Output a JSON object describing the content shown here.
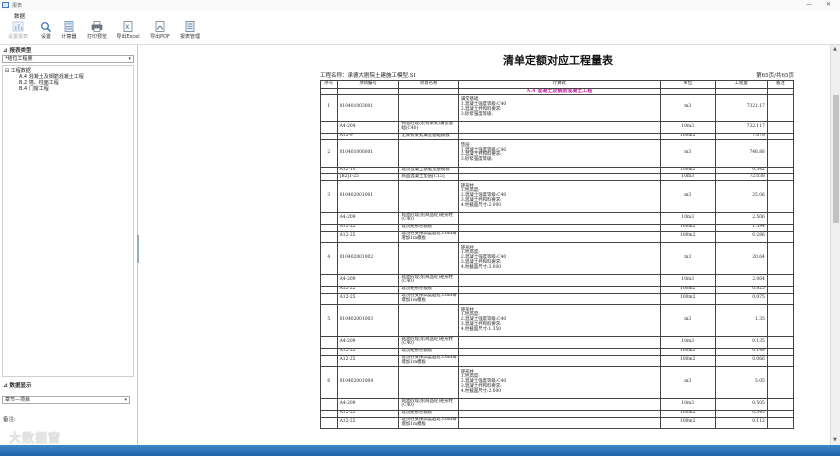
{
  "window": {
    "title": "报表",
    "minimize": "—",
    "close": "✕"
  },
  "menu": {
    "items": [
      {
        "label": "数据"
      }
    ]
  },
  "toolbar": {
    "tools": [
      {
        "label": "设置报表",
        "icon": "bar-chart-icon",
        "enabled": false
      },
      {
        "label": "设置",
        "icon": "search-icon",
        "enabled": true
      },
      {
        "label": "计算器",
        "icon": "calculator-icon",
        "enabled": true
      },
      {
        "label": "打印预览",
        "icon": "printer-icon",
        "enabled": true
      },
      {
        "label": "导出Excel",
        "icon": "excel-icon",
        "enabled": true
      },
      {
        "label": "导出PDF",
        "icon": "pdf-icon",
        "enabled": true
      },
      {
        "label": "报表管理",
        "icon": "report-manage-icon",
        "enabled": true
      }
    ]
  },
  "left": {
    "report_type_header": "报表类型",
    "report_type_value": "*结位工程量",
    "tree": [
      {
        "label": "⊟ 工程数据",
        "level": 0
      },
      {
        "label": "A.4 混凝土及钢筋混凝土工程",
        "level": 1
      },
      {
        "label": "B.2 墙、柱面工程",
        "level": 1
      },
      {
        "label": "B.4 门窗工程",
        "level": 1
      }
    ],
    "data_display_header": "数据显示",
    "data_display_value": "章节—项目",
    "remark_label": "备注:"
  },
  "report": {
    "title": "清单定额对应工程量表",
    "project_name": "工程名称：承德大剧院土建施工模型.SI",
    "page_info": "第65页/共65页",
    "columns": [
      "序号",
      "项目编号",
      "项目名称",
      "计算式",
      "单位",
      "工程量",
      "备注"
    ],
    "section_title": "A.4 混凝土及钢筋混凝土工程",
    "groups": [
      {
        "no": "1",
        "code": "010401003001",
        "name": [
          "满堂基础",
          "1.混凝土强度等级:C40",
          "2.混凝土拌和料要求:",
          "3.砂浆强度等级:"
        ],
        "unit": "m3",
        "qty": "7321.17",
        "subs": [
          {
            "code": "A4-204",
            "name": [
              "商混砼现浇(有梁式)满堂基",
              "础(C40)"
            ],
            "unit": "10m3",
            "qty": "732.117"
          },
          {
            "code": "A12-9",
            "name": [
              "无梁有梁式满堂基础模板"
            ],
            "unit": "100m2",
            "qty": "7.678"
          }
        ]
      },
      {
        "no": "2",
        "code": "010401006001",
        "name": [
          "垫层",
          "1.混凝土强度等级:C40",
          "2.混凝土拌和料要求:",
          "3.砂浆强度等级:"
        ],
        "unit": "m3",
        "qty": "748.88",
        "subs": [
          {
            "code": "A12-10",
            "name": [
              "现浇混凝土基础垫层模板"
            ],
            "unit": "100m2",
            "qty": "0.542"
          },
          {
            "code": "[B2]1-25",
            "name": [
              "商品混凝土垫层[C15]"
            ],
            "unit": "10m3",
            "qty": "72.038"
          }
        ]
      },
      {
        "no": "3",
        "code": "010402001001",
        "name": [
          "矩形柱",
          "1.柱高度:",
          "2.混凝土强度等级:C40",
          "3.混凝土拌和料要求:",
          "4.柱截面尺寸:2.000"
        ],
        "unit": "m3",
        "qty": "25.06",
        "subs": [
          {
            "code": "A4-209",
            "name": [
              "商混砼现浇(商品砼)矩形柱",
              "(C40)"
            ],
            "unit": "10m3",
            "qty": "2.506"
          },
          {
            "code": "A12-22",
            "name": [
              "现浇矩形柱模板"
            ],
            "unit": "100m2",
            "qty": "1.394"
          },
          {
            "code": "A12-25",
            "name": [
              "现浇柱支撑高度超过3.6m每",
              "增加1m模板"
            ],
            "unit": "100m2",
            "qty": "0.286"
          }
        ]
      },
      {
        "no": "4",
        "code": "010402001002",
        "name": [
          "矩形柱",
          "1.柱高度:",
          "2.混凝土强度等级:C40",
          "3.混凝土拌和料要求:",
          "4.柱截面尺寸:3.000"
        ],
        "unit": "m3",
        "qty": "20.64",
        "subs": [
          {
            "code": "A4-209",
            "name": [
              "商混砼现浇(商品砼)矩形柱",
              "(C40)"
            ],
            "unit": "10m3",
            "qty": "2.064"
          },
          {
            "code": "A12-22",
            "name": [
              "现浇矩形柱模板"
            ],
            "unit": "100m2",
            "qty": "0.825"
          },
          {
            "code": "A12-25",
            "name": [
              "现浇柱支撑高度超过3.6m每",
              "增加1m模板"
            ],
            "unit": "100m2",
            "qty": "0.075"
          }
        ]
      },
      {
        "no": "5",
        "code": "010402001003",
        "name": [
          "矩形柱",
          "1.柱高度:",
          "2.混凝土强度等级:C40",
          "3.混凝土拌和料要求:",
          "4.柱截面尺寸:1.350"
        ],
        "unit": "m3",
        "qty": "1.35",
        "subs": [
          {
            "code": "A4-209",
            "name": [
              "商混砼现浇(商品砼)矩形柱",
              "(C40)"
            ],
            "unit": "10m3",
            "qty": "0.135"
          },
          {
            "code": "A12-22",
            "name": [
              "现浇矩形柱模板"
            ],
            "unit": "100m2",
            "qty": "0.148"
          },
          {
            "code": "A12-25",
            "name": [
              "现浇柱支撑高度超过3.6m每",
              "增加1m模板"
            ],
            "unit": "100m2",
            "qty": "0.066"
          }
        ]
      },
      {
        "no": "6",
        "code": "010402001004",
        "name": [
          "矩形柱",
          "1.柱高度:",
          "2.混凝土强度等级:C40",
          "3.混凝土拌和料要求:",
          "4.柱截面尺寸:2.000"
        ],
        "unit": "m3",
        "qty": "5.05",
        "subs": [
          {
            "code": "A4-209",
            "name": [
              "商混砼现浇(商品砼)矩形柱",
              "(C40)"
            ],
            "unit": "10m3",
            "qty": "0.505"
          },
          {
            "code": "A12-22",
            "name": [
              "现浇矩形柱模板"
            ],
            "unit": "100m2",
            "qty": "0.343"
          },
          {
            "code": "A12-25",
            "name": [
              "现浇柱支撑高度超过3.6m每",
              "增加1m模板"
            ],
            "unit": "100m2",
            "qty": "0.112"
          }
        ]
      }
    ]
  },
  "watermark": "大数据窗",
  "colors": {
    "section_accent": "#c0209c",
    "statusbar": "#2a72b8"
  }
}
